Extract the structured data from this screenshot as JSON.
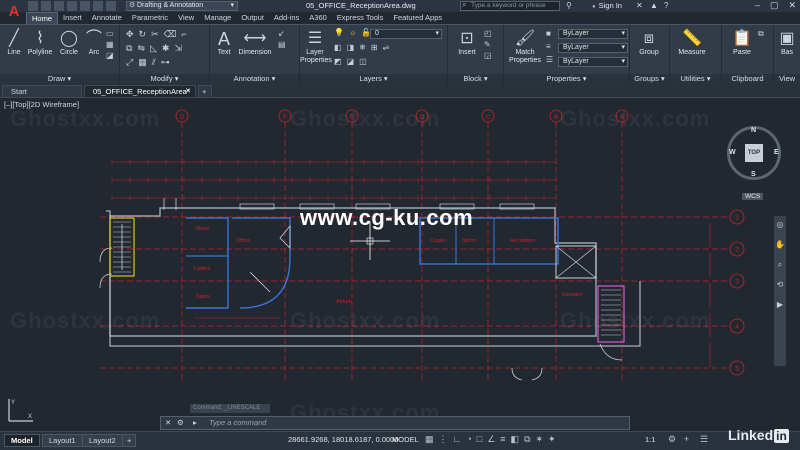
{
  "app": {
    "logo": "A",
    "workspace": "Drafting & Annotation",
    "document_title": "05_OFFICE_ReceptionArea.dwg",
    "search_placeholder": "Type a keyword or phrase",
    "signin_label": "Sign In",
    "ribbon_tabs": [
      "Home",
      "Insert",
      "Annotate",
      "Parametric",
      "View",
      "Manage",
      "Output",
      "Add-ins",
      "A360",
      "Express Tools",
      "Featured Apps"
    ],
    "active_tab": "Home"
  },
  "ribbon": {
    "panels": [
      {
        "label": "Draw",
        "tools": [
          "Line",
          "Polyline",
          "Circle",
          "Arc"
        ]
      },
      {
        "label": "Modify",
        "tools": []
      },
      {
        "label": "Annotation",
        "tools": [
          "Text",
          "Dimension"
        ]
      },
      {
        "label": "Layers",
        "tools": [
          "Layer Properties"
        ]
      },
      {
        "label": "Block",
        "tools": [
          "Insert"
        ]
      },
      {
        "label": "Properties",
        "tools": [
          "Match Properties"
        ]
      },
      {
        "label": "Groups",
        "tools": [
          "Group"
        ]
      },
      {
        "label": "Utilities",
        "tools": [
          "Measure"
        ]
      },
      {
        "label": "Clipboard",
        "tools": [
          "Paste"
        ]
      },
      {
        "label": "View",
        "tools": [
          "Bas"
        ]
      }
    ],
    "layer_dropdown": "0",
    "prop_color": "ByLayer",
    "prop_linetype": "ByLayer",
    "prop_lineweight": "ByLayer"
  },
  "file_tabs": [
    {
      "label": "Start",
      "active": false
    },
    {
      "label": "05_OFFICE_ReceptionArea*",
      "active": true
    }
  ],
  "viewport": {
    "label": "[–][Top][2D Wireframe]",
    "viewcube_top": "TOP",
    "compass": {
      "n": "N",
      "s": "S",
      "e": "E",
      "w": "W"
    },
    "wcs": "WCS"
  },
  "watermarks": {
    "ghost": "Ghostxx.com",
    "site": "www.cg-ku.com"
  },
  "plan": {
    "column_markers": [
      "G",
      "F",
      "E",
      "D",
      "C",
      "B",
      "A"
    ],
    "row_markers": [
      "1",
      "2",
      "3",
      "4",
      "5"
    ],
    "rooms": [
      {
        "name": "Mens"
      },
      {
        "name": "Office"
      },
      {
        "name": "Ladies"
      },
      {
        "name": "Stairs"
      },
      {
        "name": "Atrium"
      },
      {
        "name": "Copier"
      },
      {
        "name": "Storm"
      },
      {
        "name": "Reception"
      },
      {
        "name": "Elevator"
      }
    ]
  },
  "command": {
    "prompt": "Type a command",
    "ghost_text": "Command: _LINESCALE"
  },
  "statusbar": {
    "layout_tabs": [
      "Model",
      "Layout1",
      "Layout2"
    ],
    "active_layout": "Model",
    "coordinates": "28661.9268, 18018.6187, 0.0000",
    "space": "MODEL",
    "scale": "1:1"
  },
  "branding": {
    "linkedin": "Linked",
    "linkedin_in": "in"
  },
  "colors": {
    "background": "#212830",
    "grid_red": "#c8232c",
    "wall_blue": "#3a74d8",
    "stair_yellow": "#d8c31e",
    "stair_magenta": "#d05ad0"
  }
}
